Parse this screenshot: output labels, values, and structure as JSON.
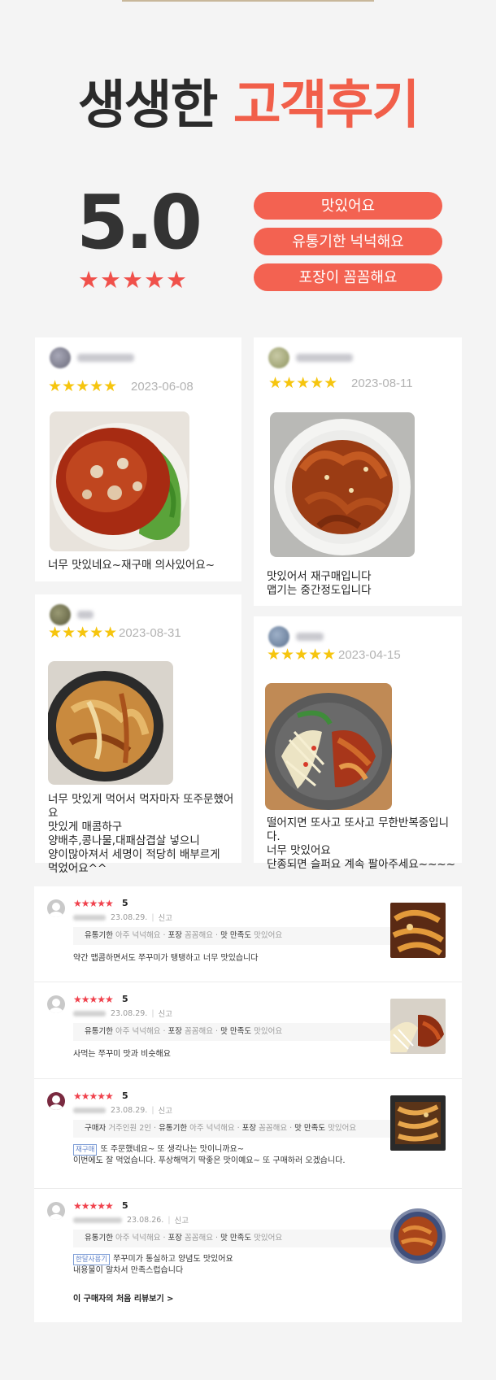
{
  "headline": {
    "part1": "생생한",
    "part2": "고객후기"
  },
  "rating": {
    "score": "5.0",
    "stars": "★★★★★"
  },
  "pills": [
    "맛있어요",
    "유통기한 넉넉해요",
    "포장이 꼼꼼해요"
  ],
  "photo_reviews": [
    {
      "stars": "★★★★★",
      "date": "2023-06-08",
      "text": "너무 맛있네요~재구매 의사있어요~"
    },
    {
      "stars": "★★★★★",
      "date": "2023-08-11",
      "text": "맛있어서 재구매입니다\n맵기는 중간정도입니다"
    },
    {
      "stars": "★★★★★",
      "date": "2023-08-31",
      "text": "너무 맛있게 먹어서 먹자마자 또주문했어요\n맛있게 매콤하구\n양배추,콩나물,대패삼겹살 넣으니\n양이많아져서 세명이 적당히 배부르게\n먹었어요^^"
    },
    {
      "stars": "★★★★★",
      "date": "2023-04-15",
      "text": "떨어지면 또사고 또사고 무한반복중입니다.\n너무 맛있어요\n단종되면 슬퍼요 계속 팔아주세요~~~~"
    }
  ],
  "store_reviews": [
    {
      "stars": "★★★★★",
      "score": "5",
      "date": "23.08.29.",
      "report": "신고",
      "tags": [
        {
          "k": "유통기한",
          "v": "아주 넉넉해요"
        },
        {
          "k": "포장",
          "v": "꼼꼼해요"
        },
        {
          "k": "맛 만족도",
          "v": "맛있어요"
        }
      ],
      "badge": "",
      "text": "약간 맵콤하면서도 쭈꾸미가 탱탱하고 너무 맛있습니다"
    },
    {
      "stars": "★★★★★",
      "score": "5",
      "date": "23.08.29.",
      "report": "신고",
      "tags": [
        {
          "k": "유통기한",
          "v": "아주 넉넉해요"
        },
        {
          "k": "포장",
          "v": "꼼꼼해요"
        },
        {
          "k": "맛 만족도",
          "v": "맛있어요"
        }
      ],
      "badge": "",
      "text": "사먹는 쭈꾸미 맛과 비슷해요"
    },
    {
      "stars": "★★★★★",
      "score": "5",
      "date": "23.08.29.",
      "report": "신고",
      "tags": [
        {
          "k": "구매자",
          "v": "거주인원 2인"
        },
        {
          "k": "유통기한",
          "v": "아주 넉넉해요"
        },
        {
          "k": "포장",
          "v": "꼼꼼해요"
        },
        {
          "k": "맛 만족도",
          "v": "맛있어요"
        }
      ],
      "badge": "재구매",
      "text": "또 주문했네요~ 또 생각나는 맛이니까요~",
      "text2": "이번에도 잘 먹었습니다. 푸상해먹기 딱좋은 맛이예요~ 또 구매하러 오겠습니다."
    },
    {
      "stars": "★★★★★",
      "score": "5",
      "date": "23.08.26.",
      "report": "신고",
      "tags": [
        {
          "k": "유통기한",
          "v": "아주 넉넉해요"
        },
        {
          "k": "포장",
          "v": "꼼꼼해요"
        },
        {
          "k": "맛 만족도",
          "v": "맛있어요"
        }
      ],
      "badge": "한달사용기",
      "text": "쭈꾸미가 통실하고 양념도 맛있어요",
      "text2": "내용물이 알차서 만족스럽습니다"
    }
  ],
  "first_review_link": "이 구매자의 처음 리뷰보기 >",
  "colors": {
    "accent": "#f15f4a",
    "pill": "#f36251",
    "star_yellow": "#f6c50e",
    "star_red": "#f0424d"
  }
}
